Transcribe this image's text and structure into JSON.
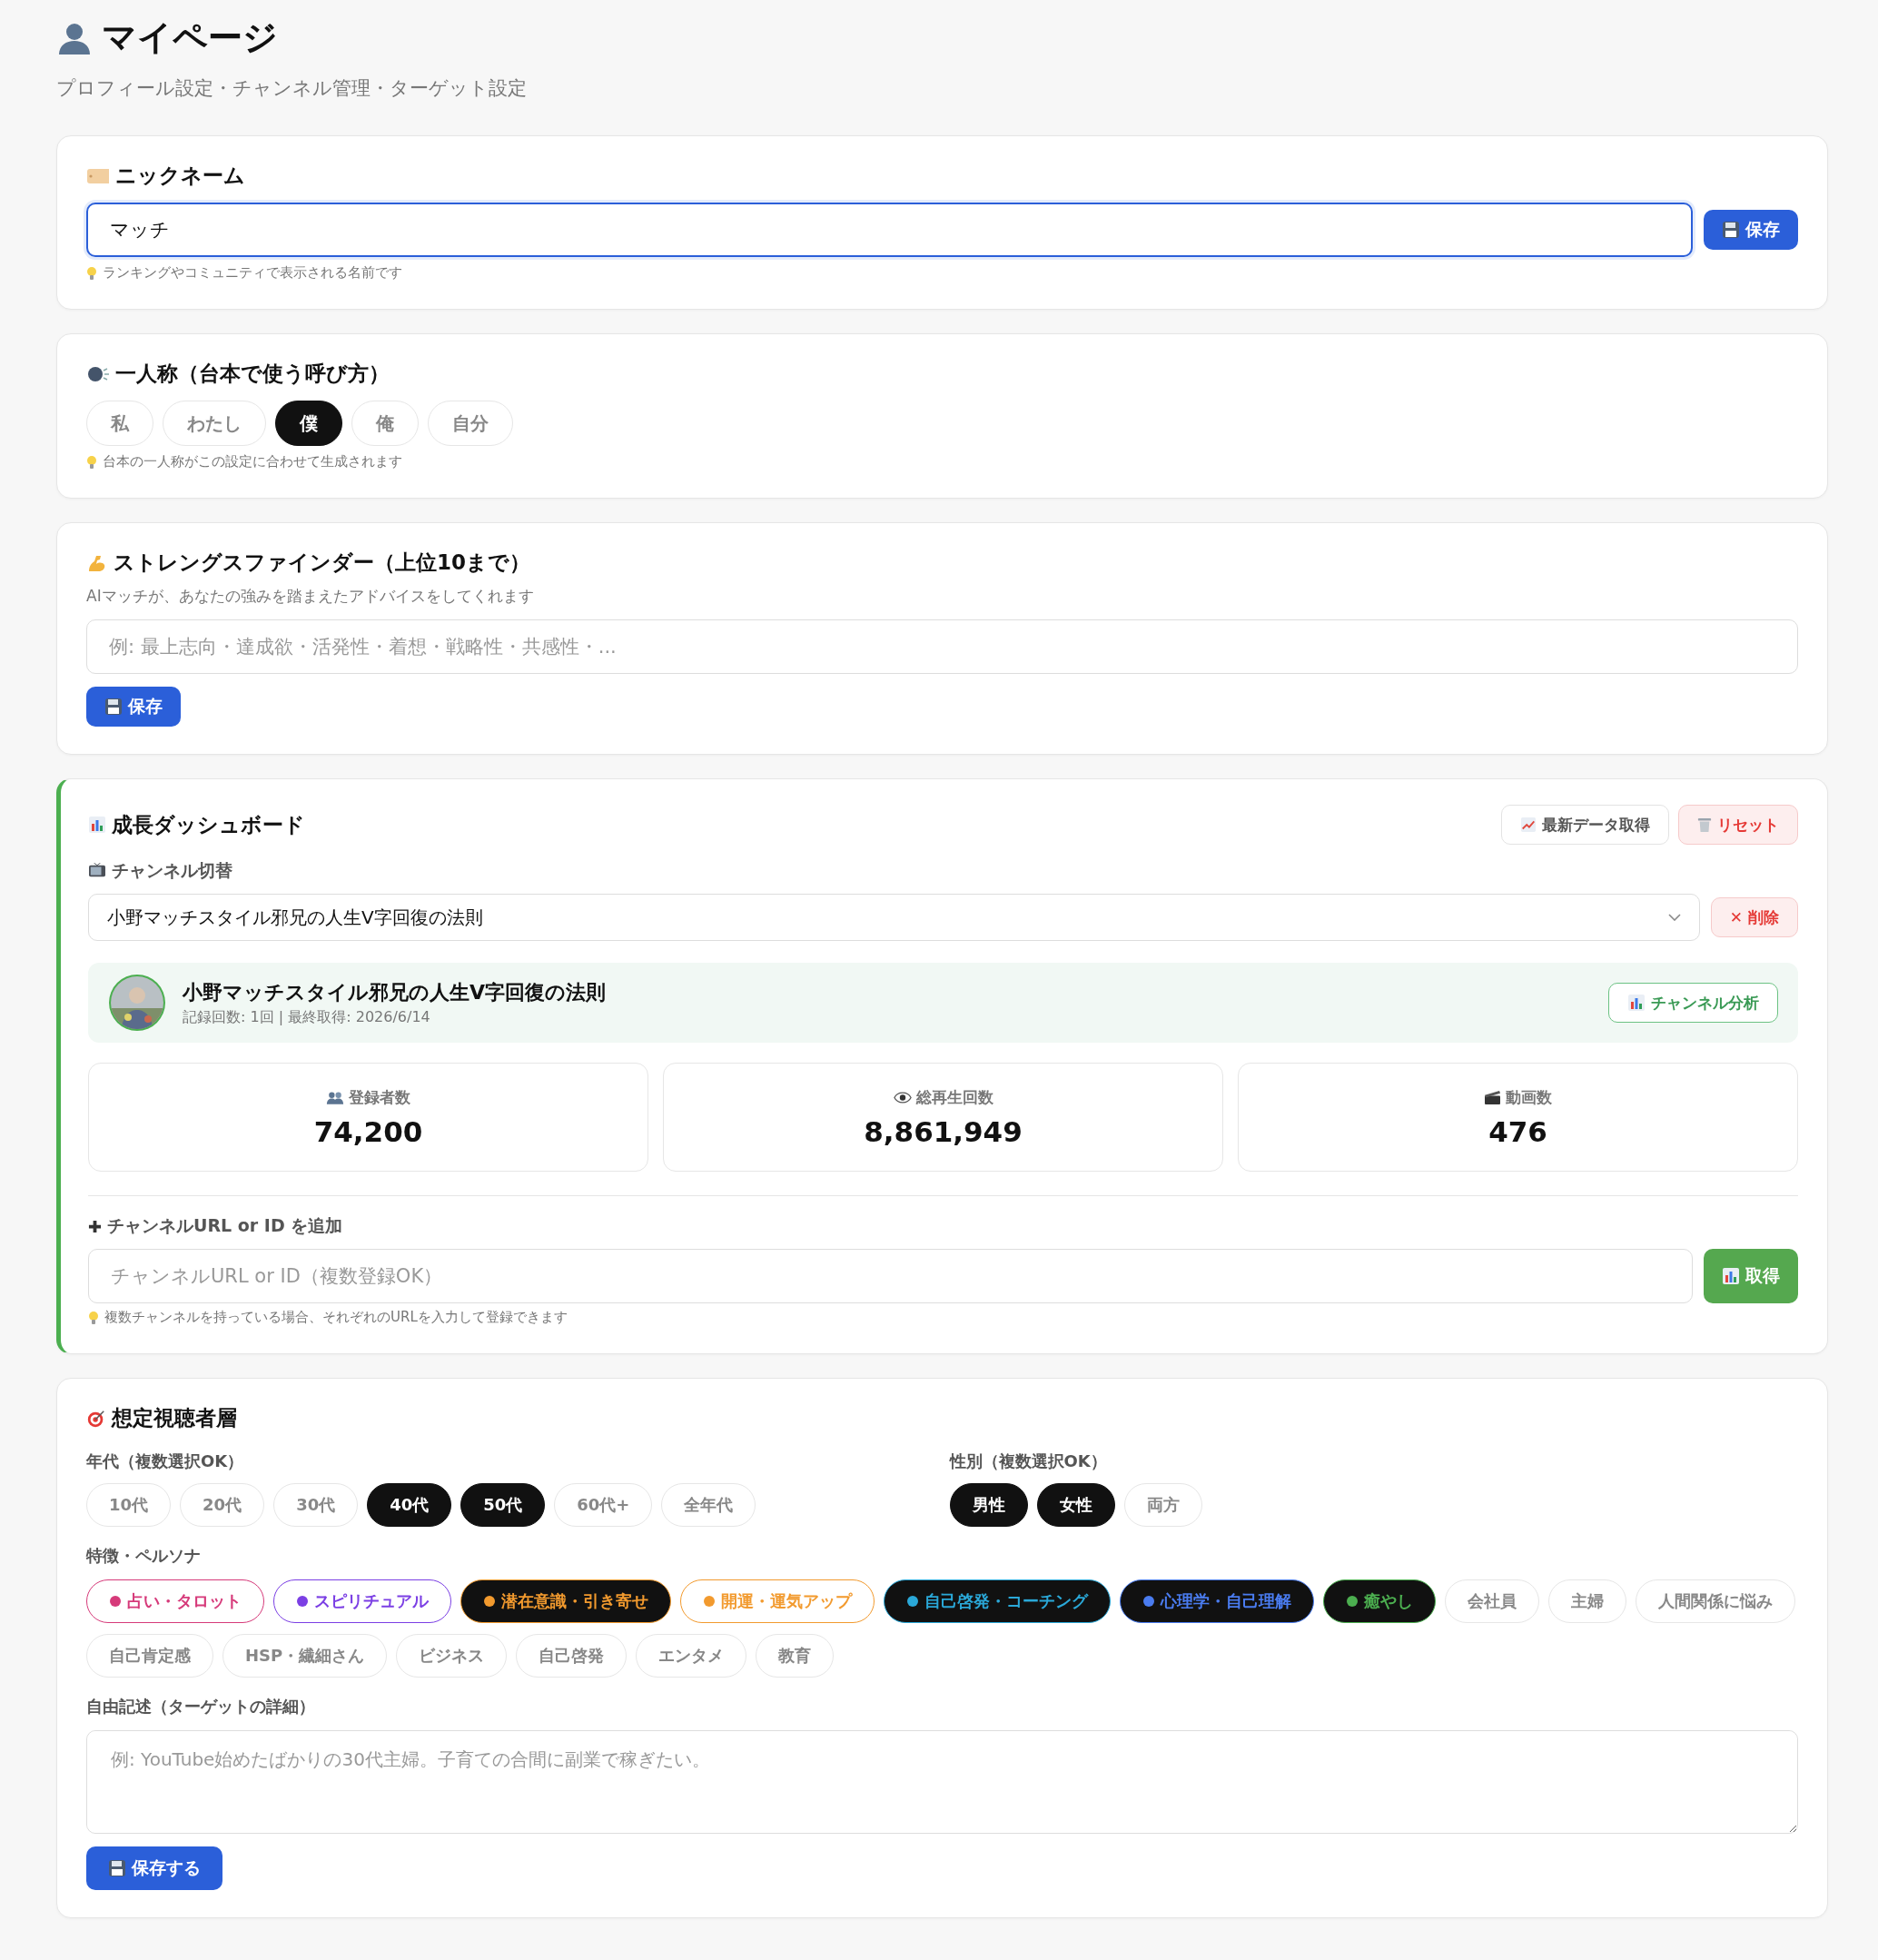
{
  "page": {
    "title": "マイページ",
    "subtitle": "プロフィール設定・チャンネル管理・ターゲット設定"
  },
  "nickname": {
    "heading": "ニックネーム",
    "value": "マッチ",
    "save_button": "保存",
    "hint": "ランキングやコミュニティで表示される名前です"
  },
  "first_person": {
    "heading": "一人称（台本で使う呼び方）",
    "options": [
      {
        "label": "私",
        "selected": false
      },
      {
        "label": "わたし",
        "selected": false
      },
      {
        "label": "僕",
        "selected": true
      },
      {
        "label": "俺",
        "selected": false
      },
      {
        "label": "自分",
        "selected": false
      }
    ],
    "hint": "台本の一人称がこの設定に合わせて生成されます"
  },
  "strengths": {
    "heading": "ストレングスファインダー（上位10まで）",
    "description": "AIマッチが、あなたの強みを踏まえたアドバイスをしてくれます",
    "placeholder": "例: 最上志向・達成欲・活発性・着想・戦略性・共感性・...",
    "save_button": "保存"
  },
  "dashboard": {
    "heading": "成長ダッシュボード",
    "refresh_button": "最新データ取得",
    "reset_button": "リセット",
    "channel_label": "チャンネル切替",
    "channel_select": "小野マッチスタイル邪兄の人生V字回復の法則",
    "delete_button": "✕ 削除",
    "channel": {
      "name": "小野マッチスタイル邪兄の人生V字回復の法則",
      "meta": "記録回数: 1回 | 最終取得: 2026/6/14",
      "analysis_button": "チャンネル分析"
    },
    "stats": [
      {
        "kind": "subscribers",
        "label": "登録者数",
        "value": "74,200"
      },
      {
        "kind": "views",
        "label": "総再生回数",
        "value": "8,861,949"
      },
      {
        "kind": "videos",
        "label": "動画数",
        "value": "476"
      }
    ],
    "add_label": "チャンネルURL or ID を追加",
    "add_placeholder": "チャンネルURL or ID（複数登録OK）",
    "fetch_button": "取得",
    "add_hint": "複数チャンネルを持っている場合、それぞれのURLを入力して登録できます"
  },
  "audience": {
    "heading": "想定視聴者層",
    "age_label": "年代（複数選択OK）",
    "ages": [
      {
        "label": "10代",
        "selected": false
      },
      {
        "label": "20代",
        "selected": false
      },
      {
        "label": "30代",
        "selected": false
      },
      {
        "label": "40代",
        "selected": true
      },
      {
        "label": "50代",
        "selected": true
      },
      {
        "label": "60代+",
        "selected": false
      },
      {
        "label": "全年代",
        "selected": false
      }
    ],
    "gender_label": "性別（複数選択OK）",
    "genders": [
      {
        "label": "男性",
        "selected": true
      },
      {
        "label": "女性",
        "selected": true
      },
      {
        "label": "両方",
        "selected": false
      }
    ],
    "persona_label": "特徴・ペルソナ",
    "personas": [
      {
        "label": "占い・タロット",
        "selected": false,
        "color": "#d63a7a"
      },
      {
        "label": "スピリチュアル",
        "selected": false,
        "color": "#7b3fe4"
      },
      {
        "label": "潜在意識・引き寄せ",
        "selected": true,
        "color": "#f29a2e"
      },
      {
        "label": "開運・運気アップ",
        "selected": false,
        "color": "#f29a2e"
      },
      {
        "label": "自己啓発・コーチング",
        "selected": true,
        "color": "#2aa8d8"
      },
      {
        "label": "心理学・自己理解",
        "selected": true,
        "color": "#4a7cf0"
      },
      {
        "label": "癒やし",
        "selected": true,
        "color": "#4caf50"
      },
      {
        "label": "会社員",
        "selected": false
      },
      {
        "label": "主婦",
        "selected": false
      },
      {
        "label": "人間関係に悩み",
        "selected": false
      },
      {
        "label": "自己肯定感",
        "selected": false
      },
      {
        "label": "HSP・繊細さん",
        "selected": false
      },
      {
        "label": "ビジネス",
        "selected": false
      },
      {
        "label": "自己啓発",
        "selected": false
      },
      {
        "label": "エンタメ",
        "selected": false
      },
      {
        "label": "教育",
        "selected": false
      }
    ],
    "free_label": "自由記述（ターゲットの詳細）",
    "free_placeholder": "例: YouTube始めたばかりの30代主婦。子育ての合間に副業で稼ぎたい。",
    "save_button": "保存する"
  }
}
